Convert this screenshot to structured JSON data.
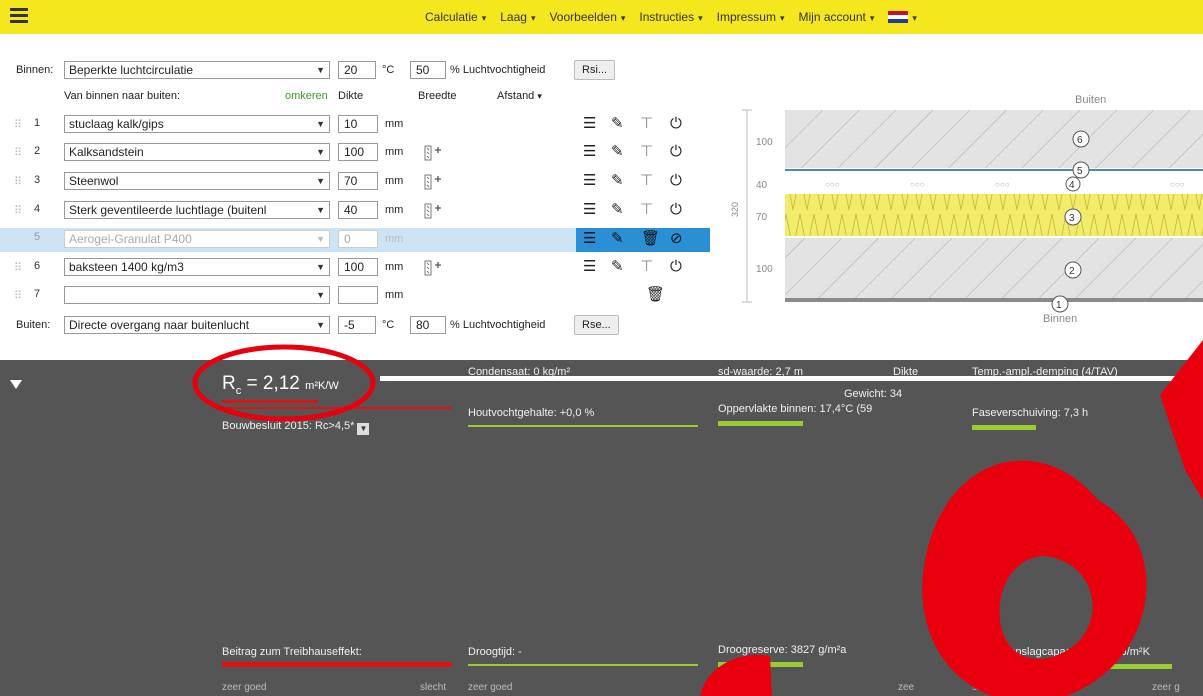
{
  "nav": {
    "items": [
      "Calculatie",
      "Laag",
      "Voorbeelden",
      "Instructies",
      "Impressum",
      "Mijn account"
    ]
  },
  "inside": {
    "label": "Binnen:",
    "condition": "Beperkte luchtcirculatie",
    "temp": "20",
    "temp_unit": "°C",
    "humidity": "50",
    "humidity_label": "% Luchtvochtigheid",
    "rsi_button": "Rsi..."
  },
  "header": {
    "direction": "Van binnen naar buiten:",
    "reverse": "omkeren",
    "thickness": "Dikte",
    "width": "Breedte",
    "distance": "Afstand"
  },
  "layers": [
    {
      "num": "1",
      "material": "stuclaag kalk/gips",
      "thickness": "10",
      "unit": "mm"
    },
    {
      "num": "2",
      "material": "Kalksandstein",
      "thickness": "100",
      "unit": "mm"
    },
    {
      "num": "3",
      "material": "Steenwol",
      "thickness": "70",
      "unit": "mm"
    },
    {
      "num": "4",
      "material": "Sterk geventileerde luchtlage (buitenl",
      "thickness": "40",
      "unit": "mm"
    },
    {
      "num": "5",
      "material": "Aerogel-Granulat P400",
      "thickness": "0",
      "unit": "mm"
    },
    {
      "num": "6",
      "material": "baksteen 1400 kg/m3",
      "thickness": "100",
      "unit": "mm"
    },
    {
      "num": "7",
      "material": "",
      "thickness": "",
      "unit": "mm"
    }
  ],
  "outside": {
    "label": "Buiten:",
    "condition": "Directe overgang naar buitenlucht",
    "temp": "-5",
    "temp_unit": "°C",
    "humidity": "80",
    "humidity_label": "% Luchtvochtigheid",
    "rse_button": "Rse..."
  },
  "diagram": {
    "top_label": "Buiten",
    "bottom_label": "Binnen",
    "total": "320",
    "dims": [
      "100",
      "40",
      "70",
      "100"
    ],
    "markers": [
      "6",
      "5",
      "4",
      "3",
      "2",
      "1"
    ]
  },
  "results": {
    "rc_symbol": "R",
    "rc_sub": "c",
    "rc_value": "= 2,12",
    "rc_unit": "m²K/W",
    "bouwbesluit": "Bouwbesluit 2015: Rc>4,5*",
    "treibhaus": "Beitrag zum Treibhauseffekt:",
    "condensaat": "Condensaat: 0 kg/m²",
    "houtvocht": "Houtvochtgehalte: +0,0 %",
    "droogtijd": "Droogtijd: -",
    "sd_waarde": "sd-waarde: 2,7 m",
    "dikte": "Dikte",
    "gewicht": "Gewicht: 34",
    "oppervlakte": "Oppervlakte binnen: 17,4°C (59",
    "droogreserve": "Droogreserve: 3827 g/m²a",
    "temp_amp": "Temp.-ampl.-demping (4/TAV)",
    "fase": "Faseverschuiving: 7,3 h",
    "opslag": "Interne opslagcapaciteit: 173 kJ/m²K",
    "zeer_goed": "zeer goed",
    "slecht": "slecht",
    "zeer_partial": "zee",
    "zeer_partial2": "zeer g"
  },
  "colors": {
    "nav_bg": "#f5e71e",
    "panel_bg": "#555555",
    "highlight": "#cde4f7",
    "annotation_red": "#e8000f",
    "insulation": "#f1ec6b"
  }
}
